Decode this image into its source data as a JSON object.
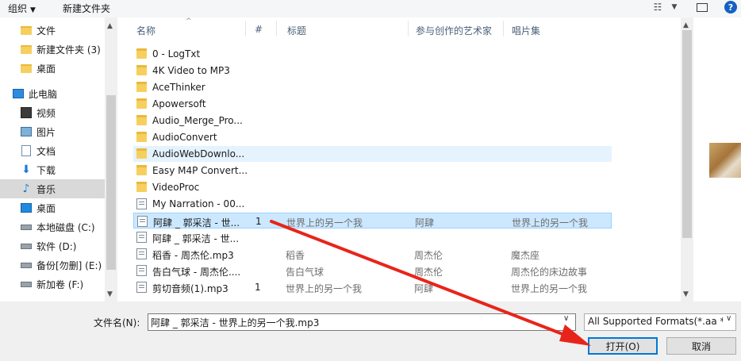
{
  "toolbar": {
    "organize_label": "组织",
    "organize_caret": "▼",
    "new_folder_label": "新建文件夹",
    "help_label": "?"
  },
  "nav": {
    "items": [
      {
        "label": "文件",
        "icon": "folder-icon"
      },
      {
        "label": "新建文件夹 (3)",
        "icon": "folder-icon"
      },
      {
        "label": "桌面",
        "icon": "folder-icon"
      },
      {
        "label": "此电脑",
        "icon": "computer-icon"
      },
      {
        "label": "视频",
        "icon": "video-icon"
      },
      {
        "label": "图片",
        "icon": "pictures-icon"
      },
      {
        "label": "文档",
        "icon": "documents-icon"
      },
      {
        "label": "下载",
        "icon": "download-icon"
      },
      {
        "label": "音乐",
        "icon": "music-icon",
        "selected": true
      },
      {
        "label": "桌面",
        "icon": "desktop-icon"
      },
      {
        "label": "本地磁盘 (C:)",
        "icon": "drive-icon"
      },
      {
        "label": "软件 (D:)",
        "icon": "drive-icon"
      },
      {
        "label": "备份[勿删] (E:)",
        "icon": "drive-icon"
      },
      {
        "label": "新加卷 (F:)",
        "icon": "drive-icon"
      }
    ]
  },
  "columns": {
    "name": "名称",
    "number": "#",
    "title": "标题",
    "artist": "参与创作的艺术家",
    "album": "唱片集"
  },
  "files": [
    {
      "type": "folder",
      "name": "0 - LogTxt",
      "num": "",
      "title": "",
      "artist": "",
      "album": ""
    },
    {
      "type": "folder",
      "name": "4K Video to MP3",
      "num": "",
      "title": "",
      "artist": "",
      "album": ""
    },
    {
      "type": "folder",
      "name": "AceThinker",
      "num": "",
      "title": "",
      "artist": "",
      "album": ""
    },
    {
      "type": "folder",
      "name": "Apowersoft",
      "num": "",
      "title": "",
      "artist": "",
      "album": ""
    },
    {
      "type": "folder",
      "name": "Audio_Merge_Pro...",
      "num": "",
      "title": "",
      "artist": "",
      "album": ""
    },
    {
      "type": "folder",
      "name": "AudioConvert",
      "num": "",
      "title": "",
      "artist": "",
      "album": ""
    },
    {
      "type": "folder",
      "name": "AudioWebDownlo...",
      "num": "",
      "title": "",
      "artist": "",
      "album": "",
      "state": "hover"
    },
    {
      "type": "folder",
      "name": "Easy M4P Convert...",
      "num": "",
      "title": "",
      "artist": "",
      "album": ""
    },
    {
      "type": "folder",
      "name": "VideoProc",
      "num": "",
      "title": "",
      "artist": "",
      "album": ""
    },
    {
      "type": "audio",
      "name": "My Narration - 00...",
      "num": "",
      "title": "",
      "artist": "",
      "album": ""
    },
    {
      "type": "audio",
      "name": "阿肆 _ 郭采洁 - 世...",
      "num": "1",
      "title": "世界上的另一个我",
      "artist": "阿肆",
      "album": "世界上的另一个我",
      "state": "selected"
    },
    {
      "type": "audio",
      "name": "阿肆 _ 郭采洁 - 世...",
      "num": "",
      "title": "",
      "artist": "",
      "album": ""
    },
    {
      "type": "audio",
      "name": "稻香 - 周杰伦.mp3",
      "num": "",
      "title": "稻香",
      "artist": "周杰伦",
      "album": "魔杰座"
    },
    {
      "type": "audio",
      "name": "告白气球 - 周杰伦....",
      "num": "",
      "title": "告白气球",
      "artist": "周杰伦",
      "album": "周杰伦的床边故事"
    },
    {
      "type": "audio",
      "name": "剪切音频(1).mp3",
      "num": "1",
      "title": "世界上的另一个我",
      "artist": "阿肆",
      "album": "世界上的另一个我"
    }
  ],
  "bottom": {
    "filename_label": "文件名(N):",
    "filename_value": "阿肆 _ 郭采洁 - 世界上的另一个我.mp3",
    "filetype_value": "All Supported Formats(*.aa *",
    "open_label": "打开(O)",
    "cancel_label": "取消"
  },
  "colors": {
    "selection_bg": "#cce8ff",
    "selection_border": "#99d1ff",
    "annotation_arrow": "#e8241a",
    "primary_button_border": "#0078d7"
  }
}
